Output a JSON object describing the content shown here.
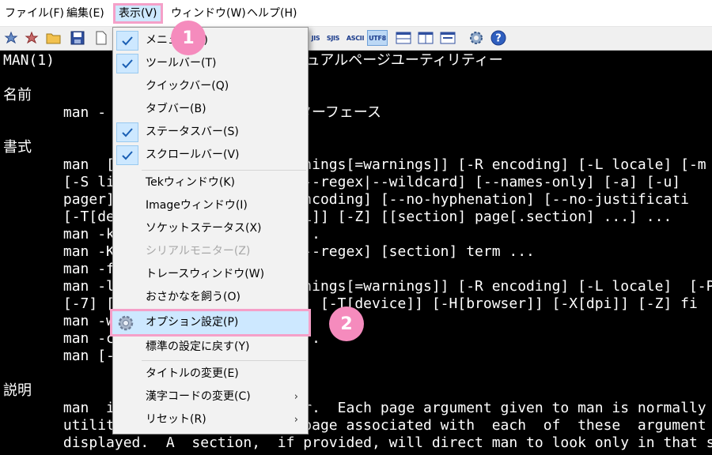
{
  "menubar": {
    "items": [
      {
        "label": "ファイル(F)"
      },
      {
        "label": "編集(E)"
      },
      {
        "label": "表示(V)"
      },
      {
        "label": "ウィンドウ(W)"
      },
      {
        "label": "ヘルプ(H)"
      }
    ]
  },
  "toolbar": {
    "encodings": [
      "SJIS",
      "ASCII",
      "UTF8"
    ]
  },
  "terminal": {
    "lines": [
      {
        "t": "MAN(1)                          マニュアルページユーティリティー"
      },
      {
        "t": "名前"
      },
      {
        "t": "       man - オ                  ンターフェース"
      },
      {
        "t": "書式"
      },
      {
        "t": "       man  [                   warnings[=warnings]] [-R encoding] [-L locale] [-m sy"
      },
      {
        "t": "       [-S li                   ] [--regex|--wildcard] [--names-only] [-a] [-u]"
      },
      {
        "t": "       pager]                   E encoding] [--no-hyphenation] [--no-justificati"
      },
      {
        "t": "       [-T[dev                  [dpi]] [-Z] [[section] page[.section] ...] ..."
      },
      {
        "t": "       man -k                   p ..."
      },
      {
        "t": "       man -K                   ] [--regex] [section] term ..."
      },
      {
        "t": "       man -f"
      },
      {
        "t": "       man -l                   warnings[=warnings]] [-R encoding] [-L locale]  [-P"
      },
      {
        "t": "       [-7] [                   [-t] [-T[device]] [-H[browser]] [-X[dpi]] [-Z] fi"
      },
      {
        "t": "       man -w                   page"
      },
      {
        "t": "       man -c                   e ..."
      },
      {
        "t": "       man [-"
      },
      {
        "t": "説明"
      },
      {
        "t": "       man  is                  ager.  Each page argument given to man is normally t"
      },
      {
        "t": "       utility                  al page associated with  each  of  these  argument"
      },
      {
        "t": "       displayed.  A  section,  if provided, will direct man to look only in that secti"
      }
    ]
  },
  "view_menu": {
    "items": [
      {
        "label": "メニュー(M)",
        "checked": true
      },
      {
        "label": "ツールバー(T)",
        "checked": true
      },
      {
        "label": "クイックバー(Q)",
        "checked": false
      },
      {
        "label": "タブバー(B)",
        "checked": false
      },
      {
        "label": "ステータスバー(S)",
        "checked": true
      },
      {
        "label": "スクロールバー(V)",
        "checked": true
      },
      {
        "label": "Tekウィンドウ(K)",
        "checked": false
      },
      {
        "label": "Imageウィンドウ(I)",
        "checked": false
      },
      {
        "label": "ソケットステータス(X)",
        "checked": false
      },
      {
        "label": "シリアルモニター(Z)",
        "checked": false,
        "disabled": true
      },
      {
        "label": "トレースウィンドウ(W)",
        "checked": false
      },
      {
        "label": "おさかなを飼う(O)",
        "checked": false
      },
      {
        "label": "オプション設定(P)",
        "checked": false,
        "icon": "gear-icon"
      },
      {
        "label": "標準の設定に戻す(Y)",
        "checked": false
      },
      {
        "label": "タイトルの変更(E)",
        "checked": false
      },
      {
        "label": "漢字コードの変更(C)",
        "checked": false,
        "submenu": true
      },
      {
        "label": "リセット(R)",
        "checked": false,
        "submenu": true
      }
    ]
  },
  "badges": [
    "1",
    "2"
  ],
  "colors": {
    "highlight_border": "#f5a0c8",
    "highlight_bg": "#cde8ff",
    "badge": "#f58bbd",
    "check": "#1a5fb4"
  }
}
